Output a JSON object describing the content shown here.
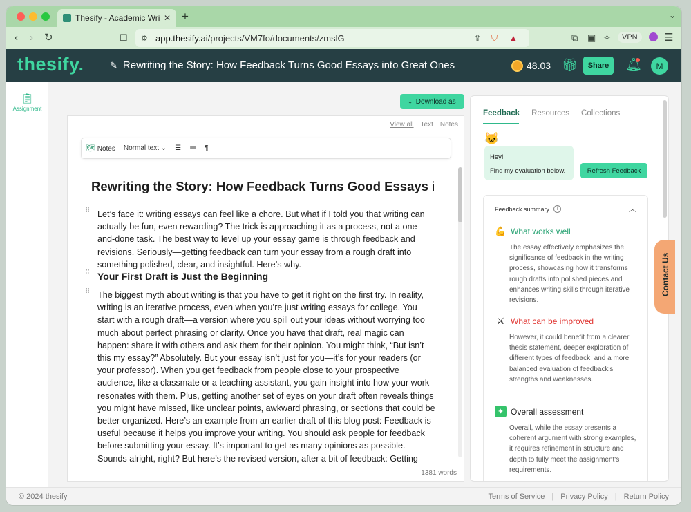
{
  "browser": {
    "tab_title": "Thesify - Academic Writing C",
    "url_host": "app.thesify.ai",
    "url_path": "/projects/VM7fo/documents/zmslG",
    "vpn_label": "VPN"
  },
  "header": {
    "logo": "thesify.",
    "doc_title": "Rewriting the Story: How Feedback Turns Good Essays into Great Ones",
    "credits": "48.03",
    "share_label": "Share",
    "avatar_initial": "M"
  },
  "rail": {
    "assignment_label": "Assignment"
  },
  "editor": {
    "download_label": "Download as",
    "view_tabs": [
      "View all",
      "Text",
      "Notes"
    ],
    "toolbar": {
      "notes_label": "Notes",
      "text_style": "Normal text"
    },
    "heading": "Rewriting the Story: How Feedback Turns Good Essays into Great Ones",
    "p1": "Let’s face it: writing essays can feel like a chore. But what if I told you that writing can actually be fun, even rewarding? The trick is approaching it as a process, not a one-and-done task. The best way to level up your essay game is through feedback and revisions. Seriously—getting feedback can turn your essay from a rough draft into something polished, clear, and insightful. Here’s why.",
    "h2": "Your First Draft is Just the Beginning",
    "p2": "The biggest myth about writing is that you have to get it right on the first try. In reality, writing is an iterative process, even when you’re just writing essays for college. You start with a rough draft—a version where you spill out your ideas without worrying too much about perfect phrasing or clarity. Once you have that draft, real magic can happen: share it with others and ask them for their opinion. You might think, “But isn’t this my essay?” Absolutely. But your essay isn’t just for you—it’s for your readers (or your professor). When you get feedback from people close to your prospective audience, like a classmate or a teaching assistant, you gain insight into how your work resonates with them. Plus, getting another set of eyes on your draft often reveals things you might have missed, like unclear points, awkward phrasing, or sections that could be better organized. Here’s an example from an earlier draft of this blog post: Feedback is useful because it helps you improve your writing. You should ask people for feedback before submitting your essay. It’s important to get as many opinions as possible. Sounds alright, right? But here’s the revised version, after a bit of feedback: Getting feedback on your essay is like holding up",
    "word_count": "1381 words"
  },
  "feedback": {
    "tabs": [
      "Feedback",
      "Resources",
      "Collections"
    ],
    "greeting": "Hey!",
    "greeting_sub": "Find my evaluation below.",
    "refresh_label": "Refresh Feedback",
    "summary_title": "Feedback summary",
    "sections": [
      {
        "title": "What works well",
        "icon": "flexed-biceps-icon",
        "text": "The essay effectively emphasizes the significance of feedback in the writing process, showcasing how it transforms rough drafts into polished pieces and enhances writing skills through iterative revisions."
      },
      {
        "title": "What can be improved",
        "icon": "crossed-swords-icon",
        "text": "However, it could benefit from a clearer thesis statement, deeper exploration of different types of feedback, and a more balanced evaluation of feedback's strengths and weaknesses."
      },
      {
        "title": "Overall assessment",
        "icon": "sparkle-check-icon",
        "text": "Overall, while the essay presents a coherent argument with strong examples, it requires refinement in structure and depth to fully meet the assignment's requirements."
      }
    ]
  },
  "contact_label": "Contact Us",
  "footer": {
    "copyright": "© 2024 thesify",
    "links": [
      "Terms of Service",
      "Privacy Policy",
      "Return Policy"
    ]
  },
  "colors": {
    "accent": "#3fd6a0",
    "header_bg": "#263f44",
    "good": "#26a272",
    "bad": "#e0332f"
  }
}
